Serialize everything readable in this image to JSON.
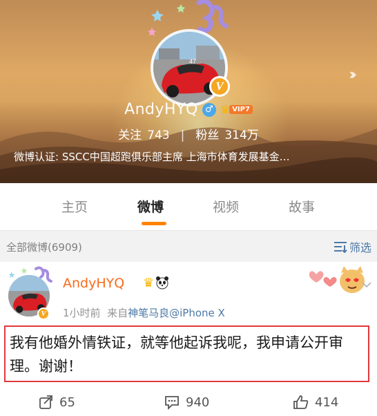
{
  "profile": {
    "name": "AndyHYQ",
    "gender_symbol": "♂",
    "vip_label": "VIP7",
    "stats": {
      "following_label": "关注",
      "following_value": "743",
      "fans_label": "粉丝",
      "fans_value": "314万"
    },
    "verification": "微博认证: SSCC中国超跑俱乐部主席 上海市体育发展基金…"
  },
  "tabs": [
    {
      "label": "主页",
      "active": false
    },
    {
      "label": "微博",
      "active": true
    },
    {
      "label": "视频",
      "active": false
    },
    {
      "label": "故事",
      "active": false
    }
  ],
  "filter": {
    "all_posts_label": "全部微博(6909)",
    "filter_label": "筛选"
  },
  "post": {
    "author": "AndyHYQ",
    "time": "1小时前",
    "source_prefix": "来自",
    "source": "神笔马良@iPhone X",
    "text": "我有他婚外情铁证，就等他起诉我呢，我申请公开审理。谢谢！",
    "actions": {
      "repost_count": "65",
      "comment_count": "940",
      "like_count": "414"
    }
  },
  "colors": {
    "accent_orange": "#ff8200",
    "username_orange": "#f86b1d",
    "link_blue": "#4d78a6",
    "highlight_red": "#e0383c"
  },
  "icons": [
    "chevron-right-icon",
    "verified-v-icon",
    "male-icon",
    "vip-crown-icon",
    "filter-icon",
    "panda-icon",
    "hearts-sticker-icon",
    "chevron-down-icon",
    "repost-icon",
    "comment-icon",
    "like-icon"
  ]
}
